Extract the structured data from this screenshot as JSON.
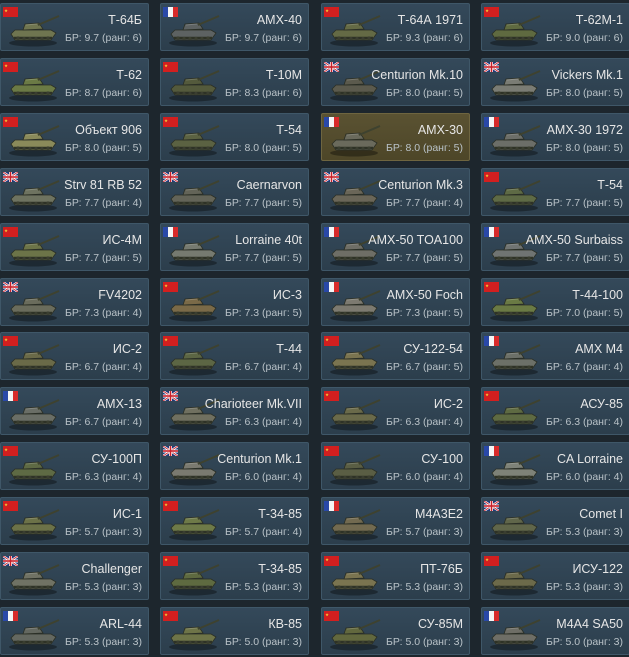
{
  "cards": [
    {
      "name": "Т-64Б",
      "br": "БР: 9.7 (ранг: 6)",
      "nation": "ussr",
      "tank_color": "#6f7550",
      "selected": false
    },
    {
      "name": "AMX-40",
      "br": "БР: 9.7 (ранг: 6)",
      "nation": "france",
      "tank_color": "#5d6262",
      "selected": false
    },
    {
      "name": "Т-64А 1971",
      "br": "БР: 9.3 (ранг: 6)",
      "nation": "ussr",
      "tank_color": "#646a45",
      "selected": false
    },
    {
      "name": "Т-62М-1",
      "br": "БР: 9.0 (ранг: 6)",
      "nation": "ussr",
      "tank_color": "#5f6a40",
      "selected": false
    },
    {
      "name": "Т-62",
      "br": "БР: 8.7 (ранг: 6)",
      "nation": "ussr",
      "tank_color": "#6b7a45",
      "selected": false
    },
    {
      "name": "Т-10М",
      "br": "БР: 8.3 (ранг: 6)",
      "nation": "ussr",
      "tank_color": "#545a3c",
      "selected": false
    },
    {
      "name": "Centurion Mk.10",
      "br": "БР: 8.0 (ранг: 5)",
      "nation": "uk",
      "tank_color": "#5b5a4d",
      "selected": false
    },
    {
      "name": "Vickers Mk.1",
      "br": "БР: 8.0 (ранг: 5)",
      "nation": "uk",
      "tank_color": "#7a7c74",
      "selected": false
    },
    {
      "name": "Объект 906",
      "br": "БР: 8.0 (ранг: 5)",
      "nation": "ussr",
      "tank_color": "#8a8a5a",
      "selected": false
    },
    {
      "name": "Т-54",
      "br": "БР: 8.0 (ранг: 5)",
      "nation": "ussr",
      "tank_color": "#5b6242",
      "selected": false
    },
    {
      "name": "AMX-30",
      "br": "БР: 8.0 (ранг: 5)",
      "nation": "france",
      "tank_color": "#6a6a5c",
      "selected": true
    },
    {
      "name": "AMX-30 1972",
      "br": "БР: 8.0 (ранг: 5)",
      "nation": "france",
      "tank_color": "#6c6e68",
      "selected": false
    },
    {
      "name": "Strv 81 RB 52",
      "br": "БР: 7.7 (ранг: 4)",
      "nation": "uk",
      "tank_color": "#6e7360",
      "selected": false
    },
    {
      "name": "Caernarvon",
      "br": "БР: 7.7 (ранг: 5)",
      "nation": "uk",
      "tank_color": "#636458",
      "selected": false
    },
    {
      "name": "Centurion Mk.3",
      "br": "БР: 7.7 (ранг: 4)",
      "nation": "uk",
      "tank_color": "#6a6658",
      "selected": false
    },
    {
      "name": "Т-54",
      "br": "БР: 7.7 (ранг: 5)",
      "nation": "ussr",
      "tank_color": "#5e6a45",
      "selected": false
    },
    {
      "name": "ИС-4М",
      "br": "БР: 7.7 (ранг: 5)",
      "nation": "ussr",
      "tank_color": "#6c7448",
      "selected": false
    },
    {
      "name": "Lorraine 40t",
      "br": "БР: 7.7 (ранг: 5)",
      "nation": "france",
      "tank_color": "#767a70",
      "selected": false
    },
    {
      "name": "AMX-50 TOA100",
      "br": "БР: 7.7 (ранг: 5)",
      "nation": "france",
      "tank_color": "#6e6e66",
      "selected": false
    },
    {
      "name": "AMX-50 Surbaiss",
      "br": "БР: 7.7 (ранг: 5)",
      "nation": "france",
      "tank_color": "#707472",
      "selected": false
    },
    {
      "name": "FV4202",
      "br": "БР: 7.3 (ранг: 4)",
      "nation": "uk",
      "tank_color": "#6a6c5c",
      "selected": false
    },
    {
      "name": "ИС-3",
      "br": "БР: 7.3 (ранг: 5)",
      "nation": "ussr",
      "tank_color": "#7a6a48",
      "selected": false
    },
    {
      "name": "AMX-50 Foch",
      "br": "БР: 7.3 (ранг: 5)",
      "nation": "france",
      "tank_color": "#7c7a70",
      "selected": false
    },
    {
      "name": "Т-44-100",
      "br": "БР: 7.0 (ранг: 5)",
      "nation": "ussr",
      "tank_color": "#6a7a44",
      "selected": false
    },
    {
      "name": "ИС-2",
      "br": "БР: 6.7 (ранг: 4)",
      "nation": "ussr",
      "tank_color": "#6a6a48",
      "selected": false
    },
    {
      "name": "Т-44",
      "br": "БР: 6.7 (ранг: 4)",
      "nation": "ussr",
      "tank_color": "#5c6644",
      "selected": false
    },
    {
      "name": "СУ-122-54",
      "br": "БР: 6.7 (ранг: 5)",
      "nation": "ussr",
      "tank_color": "#7a7450",
      "selected": false
    },
    {
      "name": "AMX M4",
      "br": "БР: 6.7 (ранг: 4)",
      "nation": "france",
      "tank_color": "#6c7068",
      "selected": false
    },
    {
      "name": "AMX-13",
      "br": "БР: 6.7 (ранг: 4)",
      "nation": "france",
      "tank_color": "#6a6e66",
      "selected": false
    },
    {
      "name": "Charioteer Mk.VII",
      "br": "БР: 6.3 (ранг: 4)",
      "nation": "uk",
      "tank_color": "#707060",
      "selected": false
    },
    {
      "name": "ИС-2",
      "br": "БР: 6.3 (ранг: 4)",
      "nation": "ussr",
      "tank_color": "#6a6a4a",
      "selected": false
    },
    {
      "name": "АСУ-85",
      "br": "БР: 6.3 (ранг: 4)",
      "nation": "ussr",
      "tank_color": "#5e6a42",
      "selected": false
    },
    {
      "name": "СУ-100П",
      "br": "БР: 6.3 (ранг: 4)",
      "nation": "ussr",
      "tank_color": "#5e6a44",
      "selected": false
    },
    {
      "name": "Centurion Mk.1",
      "br": "БР: 6.0 (ранг: 4)",
      "nation": "uk",
      "tank_color": "#7a7a70",
      "selected": false
    },
    {
      "name": "СУ-100",
      "br": "БР: 6.0 (ранг: 4)",
      "nation": "ussr",
      "tank_color": "#5a5e44",
      "selected": false
    },
    {
      "name": "CA Lorraine",
      "br": "БР: 6.0 (ранг: 4)",
      "nation": "france",
      "tank_color": "#7e8278",
      "selected": false
    },
    {
      "name": "ИС-1",
      "br": "БР: 5.7 (ранг: 3)",
      "nation": "ussr",
      "tank_color": "#6c7248",
      "selected": false
    },
    {
      "name": "Т-34-85",
      "br": "БР: 5.7 (ранг: 4)",
      "nation": "ussr",
      "tank_color": "#6e7a48",
      "selected": false
    },
    {
      "name": "M4A3E2",
      "br": "БР: 5.7 (ранг: 3)",
      "nation": "france",
      "tank_color": "#726a50",
      "selected": false
    },
    {
      "name": "Comet I",
      "br": "БР: 5.3 (ранг: 3)",
      "nation": "uk",
      "tank_color": "#60664a",
      "selected": false
    },
    {
      "name": "Challenger",
      "br": "БР: 5.3 (ранг: 3)",
      "nation": "uk",
      "tank_color": "#707264",
      "selected": false
    },
    {
      "name": "Т-34-85",
      "br": "БР: 5.3 (ранг: 3)",
      "nation": "ussr",
      "tank_color": "#5e6a40",
      "selected": false
    },
    {
      "name": "ПТ-76Б",
      "br": "БР: 5.3 (ранг: 3)",
      "nation": "ussr",
      "tank_color": "#7a7450",
      "selected": false
    },
    {
      "name": "ИСУ-122",
      "br": "БР: 5.3 (ранг: 3)",
      "nation": "ussr",
      "tank_color": "#6c6a4a",
      "selected": false
    },
    {
      "name": "ARL-44",
      "br": "БР: 5.3 (ранг: 3)",
      "nation": "france",
      "tank_color": "#646860",
      "selected": false
    },
    {
      "name": "КВ-85",
      "br": "БР: 5.0 (ранг: 3)",
      "nation": "ussr",
      "tank_color": "#6e7448",
      "selected": false
    },
    {
      "name": "СУ-85М",
      "br": "БР: 5.0 (ранг: 3)",
      "nation": "ussr",
      "tank_color": "#62683e",
      "selected": false
    },
    {
      "name": "M4A4 SA50",
      "br": "БР: 5.0 (ранг: 3)",
      "nation": "france",
      "tank_color": "#6e6e66",
      "selected": false
    }
  ]
}
